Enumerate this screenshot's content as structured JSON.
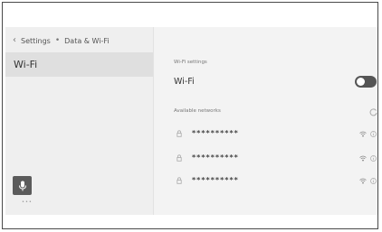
{
  "breadcrumb": {
    "back_glyph": "‹",
    "item1": "Settings",
    "separator": "•",
    "item2": "Data & Wi-Fi"
  },
  "sidebar": {
    "items": [
      {
        "label": "Wi-Fi",
        "selected": true
      }
    ]
  },
  "main": {
    "wifi_settings_header": "Wi-Fi settings",
    "wifi_toggle": {
      "label": "Wi-Fi",
      "on": true
    },
    "available_header": "Available networks",
    "networks": [
      {
        "ssid": "**********",
        "locked": true
      },
      {
        "ssid": "**********",
        "locked": true
      },
      {
        "ssid": "**********",
        "locked": true
      }
    ]
  },
  "icons": {
    "back": "chevron-left-icon",
    "refresh": "refresh-icon",
    "lock": "lock-icon",
    "signal": "wifi-signal-icon",
    "info": "info-icon",
    "mic": "microphone-icon"
  },
  "colors": {
    "background": "#f3f3f3",
    "sidebar": "#efefef",
    "selected": "#dfdfdf",
    "toggle_on": "#555555"
  }
}
